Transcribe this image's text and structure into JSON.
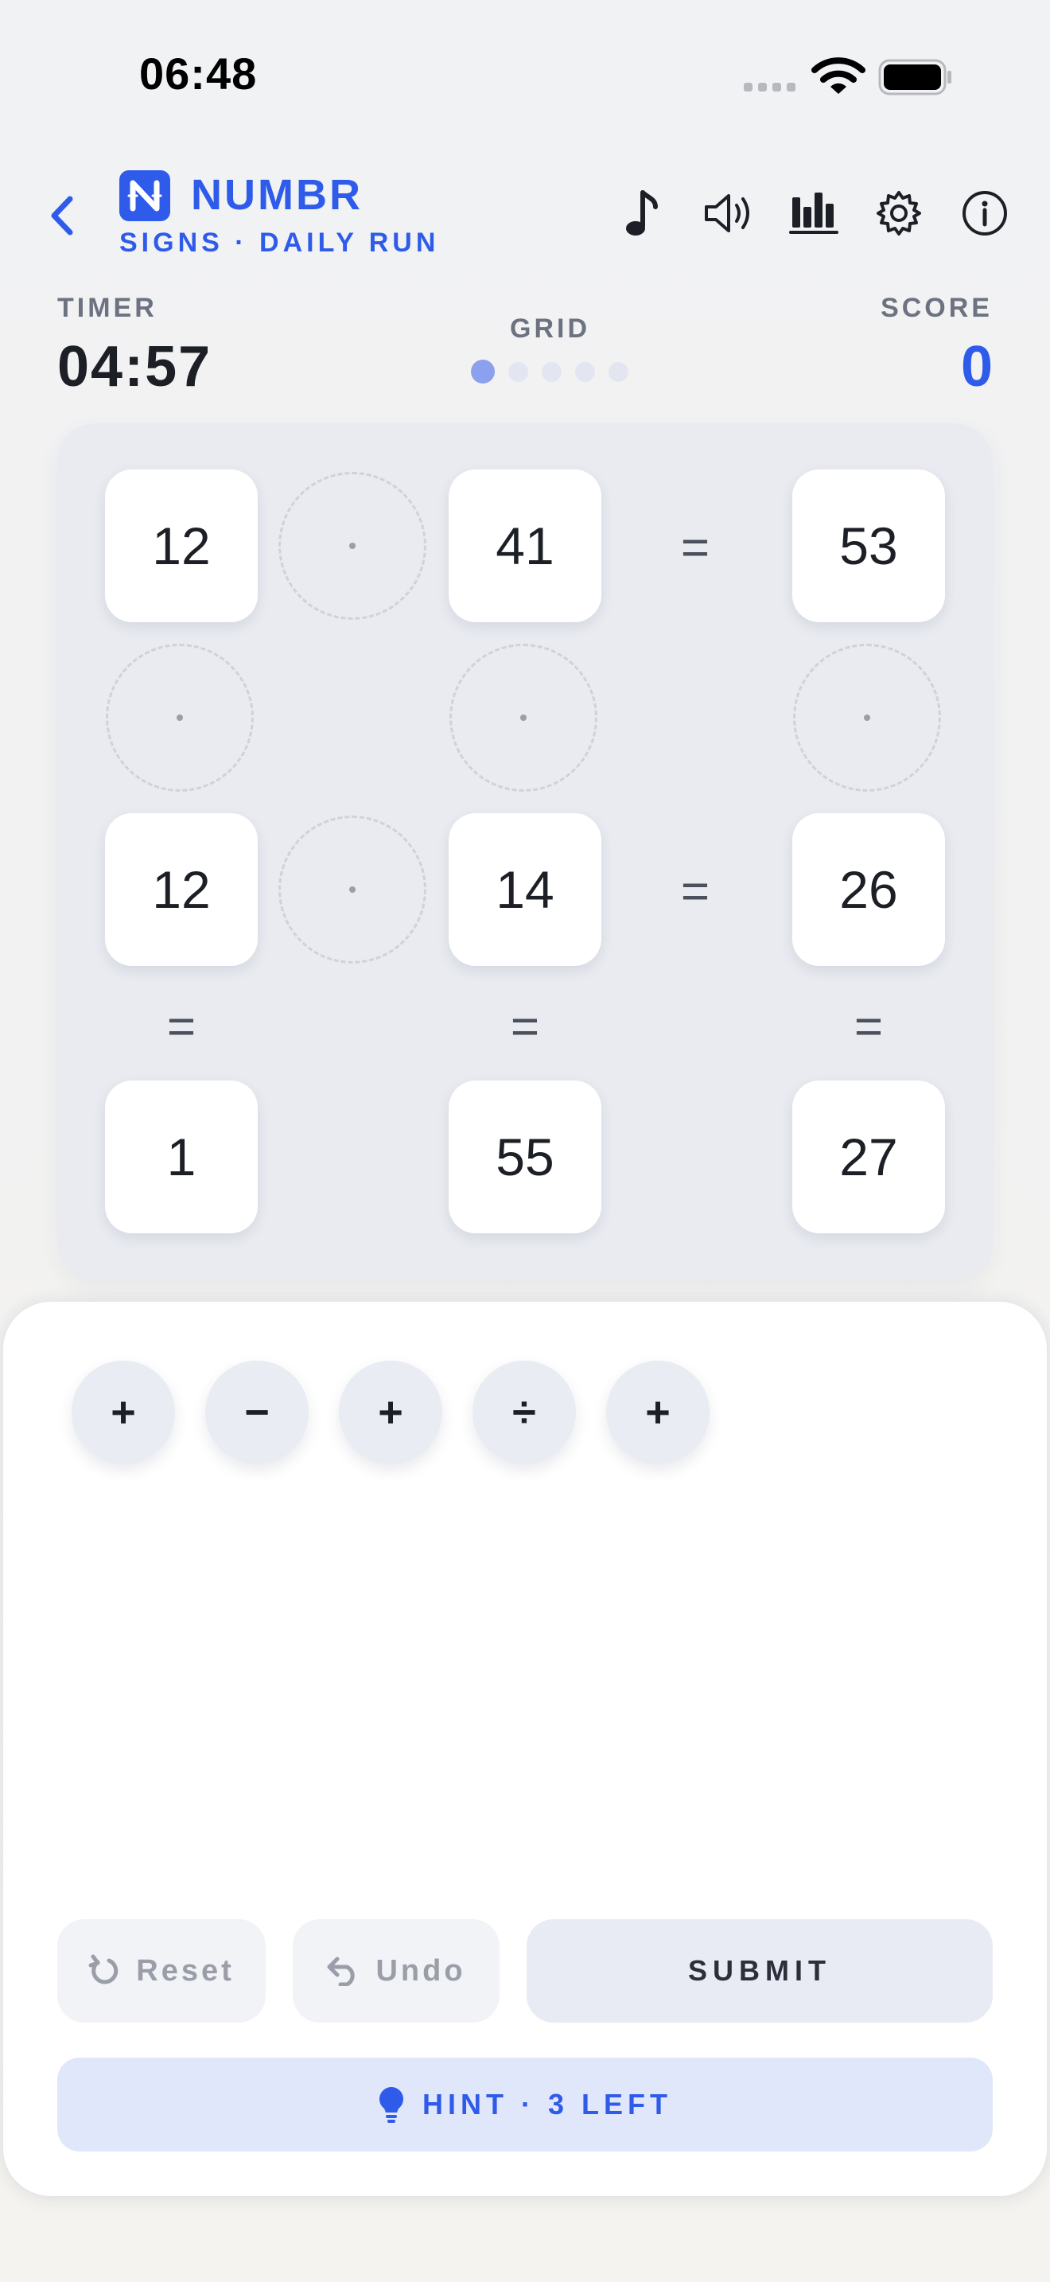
{
  "status_bar": {
    "time": "06:48"
  },
  "header": {
    "brand": "NUMBR",
    "subtitle": "SIGNS · DAILY RUN",
    "icons": [
      "back-chevron-icon",
      "logo-icon",
      "music-note-icon",
      "speaker-icon",
      "stats-icon",
      "gear-icon",
      "info-icon"
    ]
  },
  "stats": {
    "timer_label": "TIMER",
    "timer_value": "04:57",
    "grid_label": "GRID",
    "grid_progress": {
      "current": 1,
      "total": 5
    },
    "score_label": "SCORE",
    "score_value": "0"
  },
  "board": {
    "row1": {
      "a": "12",
      "b": "41",
      "eq": "=",
      "result": "53"
    },
    "row2": {
      "a": "12",
      "b": "14",
      "eq": "=",
      "result": "26"
    },
    "col_eq": [
      "=",
      "=",
      "="
    ],
    "bottom": [
      "1",
      "55",
      "27"
    ]
  },
  "operators": [
    "+",
    "−",
    "+",
    "÷",
    "+"
  ],
  "controls": {
    "reset": "Reset",
    "undo": "Undo",
    "submit": "SUBMIT",
    "hint": "HINT · 3 LEFT"
  },
  "colors": {
    "accent": "#2f5bea",
    "board_bg": "#e9ebf1",
    "hint_bg": "#e1e7fb"
  }
}
